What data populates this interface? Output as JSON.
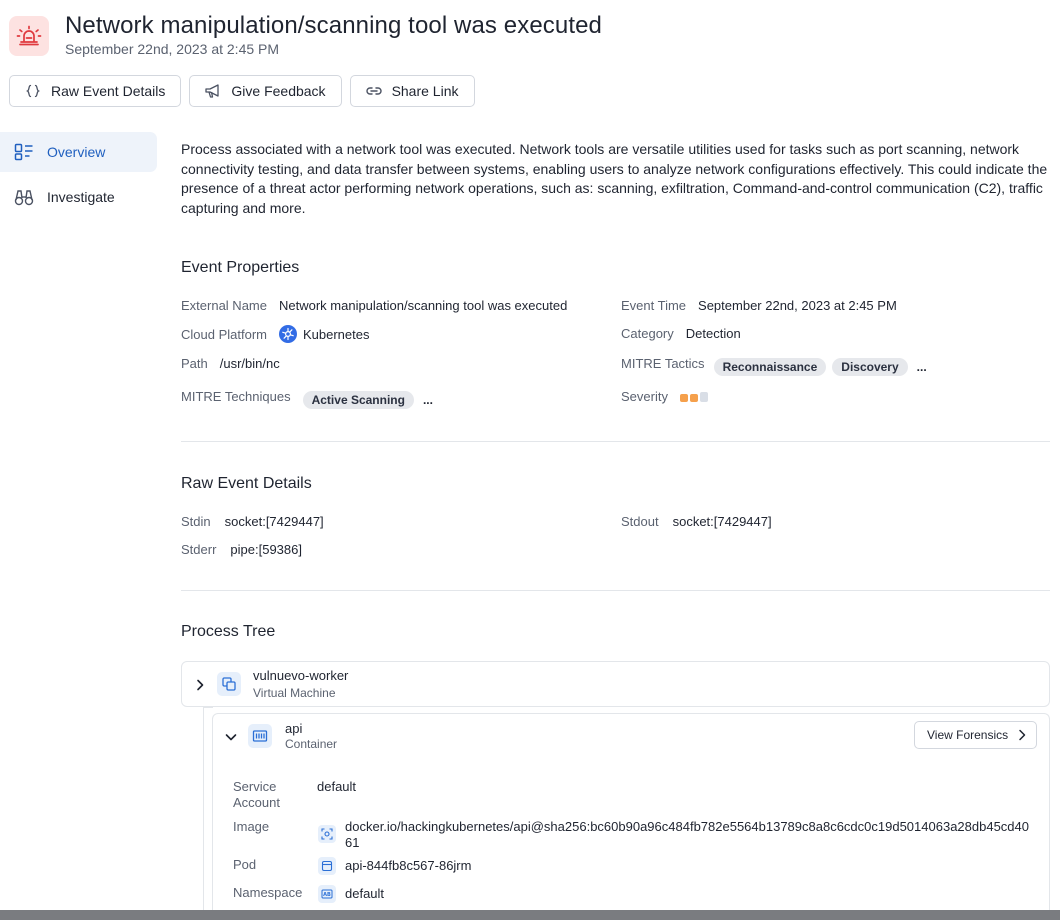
{
  "header": {
    "title": "Network manipulation/scanning tool was executed",
    "subtitle": "September 22nd, 2023 at 2:45 PM",
    "alert_icon": "siren-icon",
    "alert_bg": "#fde2e1",
    "alert_color": "#e0393e"
  },
  "toolbar": {
    "raw_event_details": "Raw Event Details",
    "give_feedback": "Give Feedback",
    "share_link": "Share Link"
  },
  "sidebar": {
    "items": [
      {
        "label": "Overview",
        "icon": "overview-icon",
        "active": true
      },
      {
        "label": "Investigate",
        "icon": "binoculars-icon",
        "active": false
      }
    ]
  },
  "description": "Process associated with a network tool was executed. Network tools are versatile utilities used for tasks such as port scanning, network connectivity testing, and data transfer between systems, enabling users to analyze network configurations effectively. This could indicate the presence of a threat actor performing network operations, such as: scanning, exfiltration, Command-and-control communication (C2), traffic capturing and more.",
  "event_properties": {
    "title": "Event Properties",
    "external_name_label": "External Name",
    "external_name": "Network manipulation/scanning tool was executed",
    "event_time_label": "Event Time",
    "event_time": "September 22nd, 2023 at 2:45 PM",
    "cloud_platform_label": "Cloud Platform",
    "cloud_platform": "Kubernetes",
    "category_label": "Category",
    "category": "Detection",
    "path_label": "Path",
    "path": "/usr/bin/nc",
    "mitre_tactics_label": "MITRE Tactics",
    "mitre_tactics": [
      "Reconnaissance",
      "Discovery"
    ],
    "mitre_techniques_label": "MITRE Techniques",
    "mitre_techniques": [
      "Active Scanning"
    ],
    "more": "...",
    "severity_label": "Severity",
    "severity_level": 2,
    "severity_max": 3,
    "severity_color": "#f5a04c"
  },
  "raw_event_details": {
    "title": "Raw Event Details",
    "stdin_label": "Stdin",
    "stdin": "socket:[7429447]",
    "stdout_label": "Stdout",
    "stdout": "socket:[7429447]",
    "stderr_label": "Stderr",
    "stderr": "pipe:[59386]"
  },
  "process_tree": {
    "title": "Process Tree",
    "nodes": [
      {
        "name": "vulnuevo-worker",
        "type": "Virtual Machine",
        "icon": "virtual-machine-icon",
        "expanded": false
      },
      {
        "name": "api",
        "type": "Container",
        "icon": "container-icon",
        "expanded": true,
        "action": "View Forensics",
        "details": {
          "service_account_label": "Service Account",
          "service_account": "default",
          "image_label": "Image",
          "image": "docker.io/hackingkubernetes/api@sha256:bc60b90a96c484fb782e5564b13789c8a8c6cdc0c19d5014063a28db45cd4061",
          "pod_label": "Pod",
          "pod": "api-844fb8c567-86jrm",
          "namespace_label": "Namespace",
          "namespace": "default"
        }
      }
    ]
  }
}
